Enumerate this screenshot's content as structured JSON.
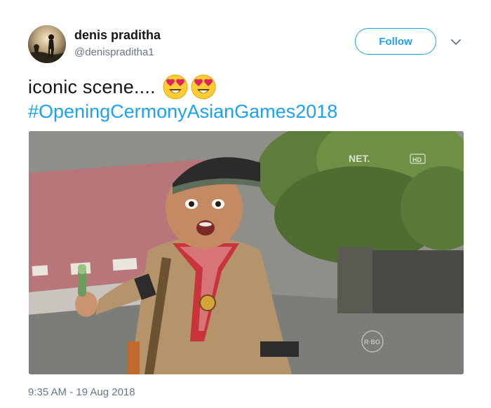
{
  "user": {
    "display_name": "denis praditha",
    "handle": "@denispraditha1",
    "avatar_icon": "profile-photo-silhouette"
  },
  "actions": {
    "follow_label": "Follow",
    "menu_icon": "chevron-down-icon"
  },
  "tweet": {
    "text": "iconic scene....",
    "emojis": [
      "heart-eyes-emoji",
      "heart-eyes-emoji"
    ],
    "hashtag": "#OpeningCermonyAsianGames2018",
    "timestamp": "9:35 AM - 19 Aug 2018"
  },
  "media": {
    "watermark": "NET.",
    "watermark_badge": "HD",
    "corner_mark": "R·BO"
  },
  "colors": {
    "accent": "#1da1f2",
    "text": "#14171a",
    "secondary_text": "#657786"
  }
}
